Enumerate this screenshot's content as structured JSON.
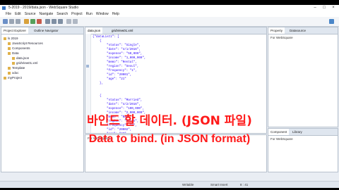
{
  "window": {
    "title": "5-2019 - 2019/data.json - WebSquare Studio",
    "minimize": "–",
    "maximize": "□",
    "close": "×"
  },
  "menu": [
    "File",
    "Edit",
    "Source",
    "Navigate",
    "Search",
    "Project",
    "Run",
    "Window",
    "Help"
  ],
  "left_panel": {
    "tabs": [
      "Project Explorer",
      "Outline Navigator"
    ],
    "tree": [
      {
        "label": "ls 2019",
        "indent": 0
      },
      {
        "label": "JavaScript Resources",
        "indent": 1
      },
      {
        "label": "Components",
        "indent": 1
      },
      {
        "label": "Data",
        "indent": 1
      },
      {
        "label": "data.json",
        "indent": 2
      },
      {
        "label": "gridView01.xml",
        "indent": 2
      },
      {
        "label": "Template",
        "indent": 1
      },
      {
        "label": "xdoc",
        "indent": 1
      },
      {
        "label": "myProject",
        "indent": 0
      }
    ]
  },
  "editor": {
    "tabs": [
      "data.json",
      "gridView01.xml"
    ],
    "lines": [
      "{\"dataList1\": [",
      "    {",
      "        \"status\": \"Single\",",
      "        \"date\": \"4/1/2016\",",
      "        \"expense\": \"50,000\",",
      "        \"income\": \"1,000,000\",",
      "        \"memo\": \"Rental\",",
      "        \"region\": \"Seoul\",",
      "        \"frequency\": \"1\",",
      "        \"id\": \"20001\",",
      "        \"age\": \"21\"",
      "    },",
      "",
      "",
      "    {",
      "        \"status\": \"Married\",",
      "        \"date\": \"4/2/2016\",",
      "        \"expense\": \"100,000\",",
      "        \"income\": \"2,000,000\",",
      "        \"memo\": \"Bank\",",
      "        \"region\": \"Busan\",",
      "        \"frequency\": \"2\",",
      "        \"id\": \"20002\",",
      "        \"age\": \"27\""
    ]
  },
  "right_panel": {
    "tabs": [
      "Property",
      "Datasource"
    ],
    "content": "For WebSquare"
  },
  "right_lower": {
    "tabs": [
      "Component",
      "Library"
    ],
    "content": "For WebSquare"
  },
  "bottom_panel": {
    "content": "For WebSquare"
  },
  "status_bar": {
    "writable": "Writable",
    "insert_mode": "Smart Insert",
    "position": "8 : 41"
  },
  "captions": {
    "korean": "바인드 할 데이터. (JSON 파일)",
    "english": "Data to bind. (in JSON format)"
  },
  "colors": {
    "caption": "#ff1a1a",
    "string": "#2a00ff",
    "panel_border": "#b7c1cd"
  }
}
